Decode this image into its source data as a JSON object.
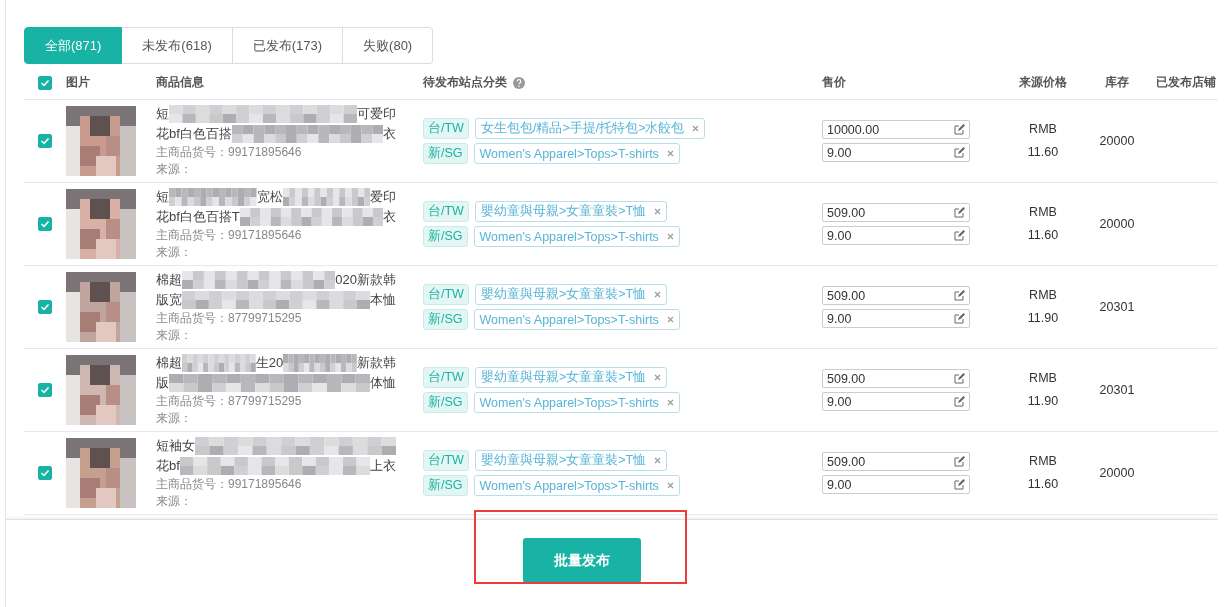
{
  "tabs": [
    {
      "label": "全部(871)",
      "selected": true
    },
    {
      "label": "未发布(618)",
      "selected": false
    },
    {
      "label": "已发布(173)",
      "selected": false
    },
    {
      "label": "失败(80)",
      "selected": false
    }
  ],
  "table": {
    "all_checked": true,
    "columns": [
      {
        "label": "图片"
      },
      {
        "label": "商品信息",
        "kind": "info"
      },
      {
        "label": "待发布站点分类",
        "kind": "category",
        "help": true
      },
      {
        "label": "售价",
        "kind": "price"
      },
      {
        "label": "来源价格",
        "kind": "source"
      },
      {
        "label": "库存",
        "kind": "stock"
      },
      {
        "label": "已发布店铺",
        "kind": "shops"
      }
    ],
    "rows": [
      {
        "checked": true,
        "title_lines": [
          [
            "短",
            "可爱印"
          ],
          [
            "花bf白色百搭",
            "衣"
          ]
        ],
        "sku_label": "主商品货号：",
        "sku": "99171895646",
        "source_label": "来源：",
        "categories": [
          {
            "site": "台/TW",
            "path": "女生包包/精品>手提/托特包>水餃包"
          },
          {
            "site": "新/SG",
            "path": "Women's Apparel>Tops>T-shirts"
          }
        ],
        "prices": [
          "10000.00",
          "9.00"
        ],
        "currency": "RMB",
        "source_price": "11.60",
        "stock": "20000"
      },
      {
        "checked": true,
        "title_lines": [
          [
            "短",
            "宽松",
            "爱印"
          ],
          [
            "花bf白色百搭T",
            "衣"
          ]
        ],
        "sku_label": "主商品货号：",
        "sku": "99171895646",
        "source_label": "来源：",
        "categories": [
          {
            "site": "台/TW",
            "path": "嬰幼童與母親>女童童裝>T恤"
          },
          {
            "site": "新/SG",
            "path": "Women's Apparel>Tops>T-shirts"
          }
        ],
        "prices": [
          "509.00",
          "9.00"
        ],
        "currency": "RMB",
        "source_price": "11.60",
        "stock": "20000"
      },
      {
        "checked": true,
        "title_lines": [
          [
            "棉超",
            "020新款韩"
          ],
          [
            "版宽",
            "本恤"
          ]
        ],
        "sku_label": "主商品货号：",
        "sku": "87799715295",
        "source_label": "来源：",
        "categories": [
          {
            "site": "台/TW",
            "path": "嬰幼童與母親>女童童裝>T恤"
          },
          {
            "site": "新/SG",
            "path": "Women's Apparel>Tops>T-shirts"
          }
        ],
        "prices": [
          "509.00",
          "9.00"
        ],
        "currency": "RMB",
        "source_price": "11.90",
        "stock": "20301"
      },
      {
        "checked": true,
        "title_lines": [
          [
            "棉超",
            "生20",
            "新款韩"
          ],
          [
            "版",
            "体恤"
          ]
        ],
        "sku_label": "主商品货号：",
        "sku": "87799715295",
        "source_label": "来源：",
        "categories": [
          {
            "site": "台/TW",
            "path": "嬰幼童與母親>女童童裝>T恤"
          },
          {
            "site": "新/SG",
            "path": "Women's Apparel>Tops>T-shirts"
          }
        ],
        "prices": [
          "509.00",
          "9.00"
        ],
        "currency": "RMB",
        "source_price": "11.90",
        "stock": "20301"
      },
      {
        "checked": true,
        "title_lines": [
          [
            "短袖女"
          ],
          [
            "花bf",
            "上衣"
          ]
        ],
        "sku_label": "主商品货号：",
        "sku": "99171895646",
        "source_label": "来源：",
        "categories": [
          {
            "site": "台/TW",
            "path": "嬰幼童與母親>女童童裝>T恤"
          },
          {
            "site": "新/SG",
            "path": "Women's Apparel>Tops>T-shirts"
          }
        ],
        "prices": [
          "509.00",
          "9.00"
        ],
        "currency": "RMB",
        "source_price": "11.60",
        "stock": "20000"
      }
    ]
  },
  "footer": {
    "publish_button": "批量发布"
  }
}
